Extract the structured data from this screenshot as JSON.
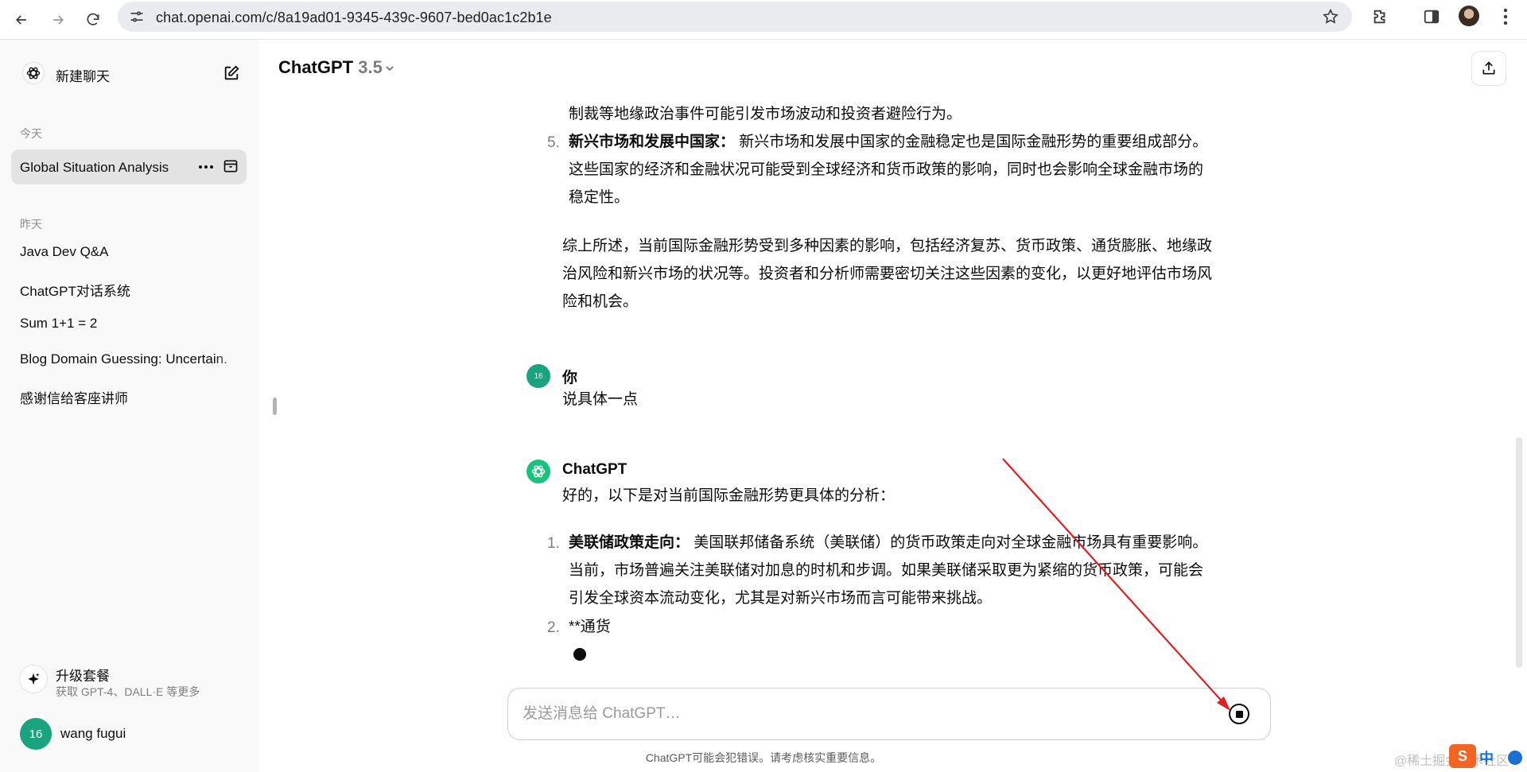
{
  "browser": {
    "url": "chat.openai.com/c/8a19ad01-9345-439c-9607-bed0ac1c2b1e",
    "icons": [
      "back-icon",
      "forward-icon",
      "reload-icon",
      "site-settings-icon",
      "bookmark-star-icon",
      "extensions-icon",
      "side-panel-icon",
      "profile-avatar",
      "browser-menu-icon"
    ]
  },
  "sidebar": {
    "new_chat_label": "新建聊天",
    "today_label": "今天",
    "yesterday_label": "昨天",
    "today_items": [
      {
        "label": "Global Situation Analysis"
      }
    ],
    "yesterday_items": [
      {
        "label": "Java Dev Q&A"
      },
      {
        "label": "ChatGPT对话系统"
      },
      {
        "label": "Sum 1+1 = 2"
      },
      {
        "label": "Blog Domain Guessing: Uncertain."
      },
      {
        "label": "感谢信给客座讲师"
      }
    ],
    "upgrade_title": "升级套餐",
    "upgrade_subtitle": "获取 GPT-4、DALL·E 等更多",
    "user_initials": "16",
    "user_name": "wang fugui"
  },
  "header": {
    "model_name": "ChatGPT",
    "model_version": "3.5"
  },
  "conversation": {
    "prev_line": "制裁等地缘政治事件可能引发市场波动和投资者避险行为。",
    "item5_num": "5.",
    "item5_bold": "新兴市场和发展中国家：",
    "item5_line1": "新兴市场和发展中国家的金融稳定也是国际金融形势的重要组成部分。",
    "item5_line2": "这些国家的经济和金融状况可能受到全球经济和货币政策的影响，同时也会影响全球金融市场的",
    "item5_line3": "稳定性。",
    "summary_line1": "综上所述，当前国际金融形势受到多种因素的影响，包括经济复苏、货币政策、通货膨胀、地缘政",
    "summary_line2": "治风险和新兴市场的状况等。投资者和分析师需要密切关注这些因素的变化，以更好地评估市场风",
    "summary_line3": "险和机会。",
    "user_author": "你",
    "user_avatar": "16",
    "user_message": "说具体一点",
    "gpt_author": "ChatGPT",
    "gpt_intro": "好的，以下是对当前国际金融形势更具体的分析：",
    "item1_num": "1.",
    "item1_bold": "美联储政策走向：",
    "item1_line1": "美国联邦储备系统（美联储）的货币政策走向对全球金融市场具有重要影响。",
    "item1_line2": "当前，市场普遍关注美联储对加息的时机和步调。如果美联储采取更为紧缩的货币政策，可能会",
    "item1_line3": "引发全球资本流动变化，尤其是对新兴市场而言可能带来挑战。",
    "item2_num": "2.",
    "item2_text": "**通货"
  },
  "composer": {
    "placeholder": "发送消息给 ChatGPT…",
    "disclaimer": "ChatGPT可能会犯错误。请考虑核实重要信息。"
  },
  "watermark": {
    "text": "@稀土掘金技术社区",
    "badge": "S",
    "chip": "中"
  },
  "colors": {
    "accent_green": "#19c37d",
    "user_avatar": "#19a37f",
    "annotation_arrow": "#e02020"
  }
}
